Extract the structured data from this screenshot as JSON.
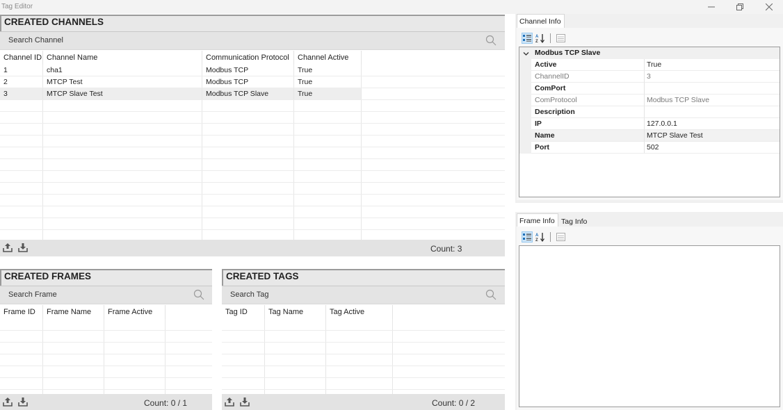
{
  "window": {
    "title": "Tag Editor"
  },
  "channels": {
    "header": "CREATED CHANNELS",
    "search_placeholder": "Search Channel",
    "columns": [
      "Channel ID",
      "Channel Name",
      "Communication Protocol",
      "Channel Active"
    ],
    "rows": [
      [
        "1",
        "cha1",
        "Modbus TCP",
        "True"
      ],
      [
        "2",
        "MTCP Test",
        "Modbus TCP",
        "True"
      ],
      [
        "3",
        "MTCP Slave Test",
        "Modbus TCP Slave",
        "True"
      ]
    ],
    "selected_row": 3,
    "count": "Count: 3"
  },
  "frames": {
    "header": "CREATED FRAMES",
    "search_placeholder": "Search Frame",
    "columns": [
      "Frame ID",
      "Frame Name",
      "Frame Active"
    ],
    "rows": [],
    "count": "Count: 0 / 1"
  },
  "tags": {
    "header": "CREATED TAGS",
    "search_placeholder": "Search Tag",
    "columns": [
      "Tag ID",
      "Tag Name",
      "Tag Active"
    ],
    "rows": [],
    "count": "Count: 0 / 2"
  },
  "channel_info": {
    "tab": "Channel Info",
    "category": "Modbus TCP Slave",
    "properties": [
      {
        "name": "Active",
        "value": "True",
        "readonly": false
      },
      {
        "name": "ChannelID",
        "value": "3",
        "readonly": true
      },
      {
        "name": "ComPort",
        "value": "",
        "readonly": false
      },
      {
        "name": "ComProtocol",
        "value": "Modbus TCP Slave",
        "readonly": true
      },
      {
        "name": "Description",
        "value": "",
        "readonly": false
      },
      {
        "name": "IP",
        "value": "127.0.0.1",
        "readonly": false
      },
      {
        "name": "Name",
        "value": "MTCP Slave Test",
        "readonly": false
      },
      {
        "name": "Port",
        "value": "502",
        "readonly": false
      }
    ],
    "selected_property": "Name"
  },
  "frame_tag_info": {
    "tabs": [
      "Frame Info",
      "Tag Info"
    ],
    "active_tab": "Frame Info"
  },
  "icons": {
    "window_controls": [
      "minimize-icon",
      "restore-icon",
      "close-icon"
    ],
    "toolbar": [
      "categorized-icon",
      "alphabetical-sort-icon",
      "property-pages-icon"
    ],
    "footer": [
      "upload-icon",
      "download-icon"
    ],
    "search": "search-icon"
  },
  "colors": {
    "header_bg": "#e8e8e8",
    "footer_bg": "#e3e3e3",
    "toolbar_active": "#cce4f7"
  }
}
